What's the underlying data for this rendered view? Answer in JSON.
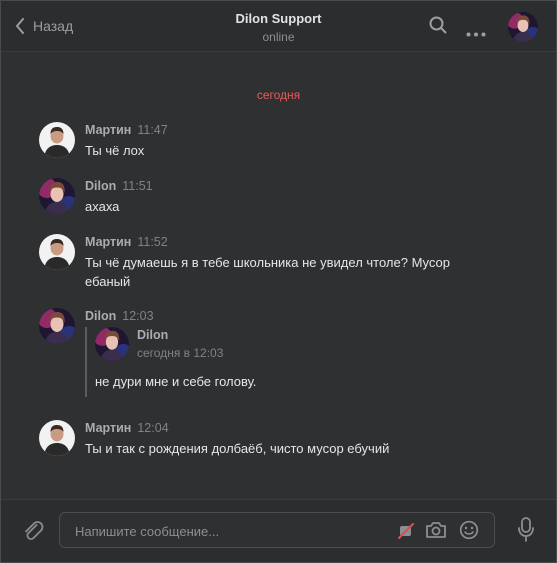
{
  "header": {
    "back_label": "Назад",
    "title": "Dilon Support",
    "status": "online"
  },
  "date_separator": "сегодня",
  "messages": [
    {
      "author": "Мартин",
      "time": "11:47",
      "text": "Ты чё лох",
      "avatar": "martin"
    },
    {
      "author": "Dilon",
      "time": "11:51",
      "text": "ахаха",
      "avatar": "dilon"
    },
    {
      "author": "Мартин",
      "time": "11:52",
      "text": "Ты чё думаешь я в тебе школьника не увидел чтоле? Мусор ебаный",
      "avatar": "martin"
    },
    {
      "author": "Dilon",
      "time": "12:03",
      "text": "не дури мне и себе голову.",
      "avatar": "dilon",
      "quote": {
        "author": "Dilon",
        "time": "сегодня в 12:03"
      }
    },
    {
      "author": "Мартин",
      "time": "12:04",
      "text": "Ты и так с рождения долбаёб, чисто мусор ебучий",
      "avatar": "martin"
    }
  ],
  "composer": {
    "placeholder": "Напишите сообщение..."
  },
  "icons": {
    "back": "chevron-left-icon",
    "search": "search-icon",
    "more": "more-dots-icon",
    "attach": "paperclip-icon",
    "sticker_off": "no-sticker-icon",
    "camera": "camera-icon",
    "emoji": "emoji-icon",
    "mic": "microphone-icon"
  },
  "colors": {
    "background": "#2f3032",
    "date_separator": "#e65c5c",
    "text": "#e4e6e9",
    "muted": "#8b8e93"
  }
}
